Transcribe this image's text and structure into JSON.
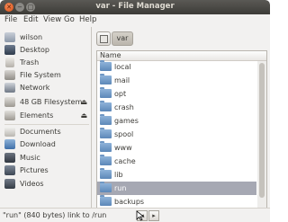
{
  "window": {
    "title": "var - File Manager"
  },
  "menubar": {
    "items": [
      "File",
      "Edit",
      "View",
      "Go",
      "Help"
    ]
  },
  "sidebar": {
    "devices": [
      {
        "label": "wilson",
        "icon": "user-home-icon",
        "eject": false
      },
      {
        "label": "Desktop",
        "icon": "desktop-icon",
        "eject": false
      },
      {
        "label": "Trash",
        "icon": "trash-icon",
        "eject": false
      },
      {
        "label": "File System",
        "icon": "filesystem-icon",
        "eject": false
      },
      {
        "label": "Network",
        "icon": "network-icon",
        "eject": false
      },
      {
        "label": "48 GB Filesystem",
        "icon": "drive-icon",
        "eject": true
      },
      {
        "label": "Elements",
        "icon": "drive-icon",
        "eject": true
      }
    ],
    "bookmarks": [
      {
        "label": "Documents",
        "icon": "documents-folder-icon"
      },
      {
        "label": "Download",
        "icon": "download-folder-icon"
      },
      {
        "label": "Music",
        "icon": "music-folder-icon"
      },
      {
        "label": "Pictures",
        "icon": "pictures-folder-icon"
      },
      {
        "label": "Videos",
        "icon": "videos-folder-icon"
      }
    ]
  },
  "pathbar": {
    "current": "var"
  },
  "list": {
    "column_header": "Name",
    "rows": [
      {
        "name": "local",
        "selected": false
      },
      {
        "name": "mail",
        "selected": false
      },
      {
        "name": "opt",
        "selected": false
      },
      {
        "name": "crash",
        "selected": false
      },
      {
        "name": "games",
        "selected": false
      },
      {
        "name": "spool",
        "selected": false
      },
      {
        "name": "www",
        "selected": false
      },
      {
        "name": "cache",
        "selected": false
      },
      {
        "name": "lib",
        "selected": false
      },
      {
        "name": "run",
        "selected": true
      },
      {
        "name": "backups",
        "selected": false
      }
    ]
  },
  "status": {
    "text": "\"run\" (840 bytes) link to /run"
  },
  "colors": {
    "selection": "#a6a8b3",
    "titlebar": "#3c3b37",
    "close_button": "#e05a1d"
  }
}
